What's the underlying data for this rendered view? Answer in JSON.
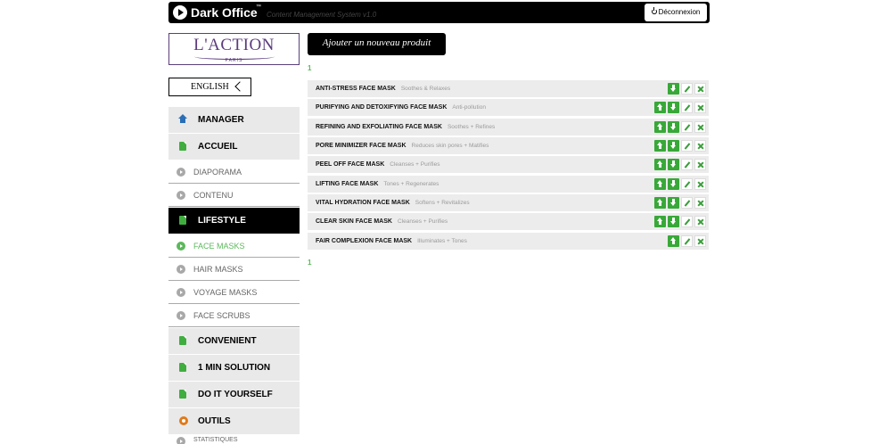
{
  "header": {
    "brand": "Dark Office",
    "tm": "™",
    "subtitle": "Content Management System v1.0",
    "logout_label": "Déconnexion"
  },
  "logo": {
    "text": "L'ACTION",
    "sub": "PARIS"
  },
  "language": {
    "label": "ENGLISH"
  },
  "nav": {
    "manager": "MANAGER",
    "accueil": "ACCUEIL",
    "diaporama": "DIAPORAMA",
    "contenu": "CONTENU",
    "lifestyle": "LIFESTYLE",
    "face_masks": "FACE MASKS",
    "hair_masks": "HAIR MASKS",
    "voyage_masks": "VOYAGE MASKS",
    "face_scrubs": "FACE SCRUBS",
    "convenient": "CONVENIENT",
    "one_min": "1 MIN SOLUTION",
    "diy": "DO IT YOURSELF",
    "outils": "OUTILS",
    "statistiques": "STATISTIQUES"
  },
  "main": {
    "add_label": "Ajouter un nouveau produit",
    "page_top": "1",
    "page_bottom": "1",
    "products": [
      {
        "name": "ANTI-STRESS FACE MASK",
        "desc": "Soothes & Relaxes"
      },
      {
        "name": "PURIFYING AND DETOXIFYING FACE MASK",
        "desc": "Anti-pollution"
      },
      {
        "name": "REFINING AND EXFOLIATING FACE MASK",
        "desc": "Soothes + Refines"
      },
      {
        "name": "PORE MINIMIZER FACE MASK",
        "desc": "Reduces skin pores + Matifies"
      },
      {
        "name": "PEEL OFF FACE MASK",
        "desc": "Cleanses + Purifies"
      },
      {
        "name": "LIFTING FACE MASK",
        "desc": "Tones + Regenerates"
      },
      {
        "name": "VITAL HYDRATION FACE MASK",
        "desc": "Softens + Revitalizes"
      },
      {
        "name": "CLEAR SKIN FACE MASK",
        "desc": "Cleanses + Purifies"
      },
      {
        "name": "FAIR COMPLEXION FACE MASK",
        "desc": "Illuminates + Tones"
      }
    ]
  }
}
